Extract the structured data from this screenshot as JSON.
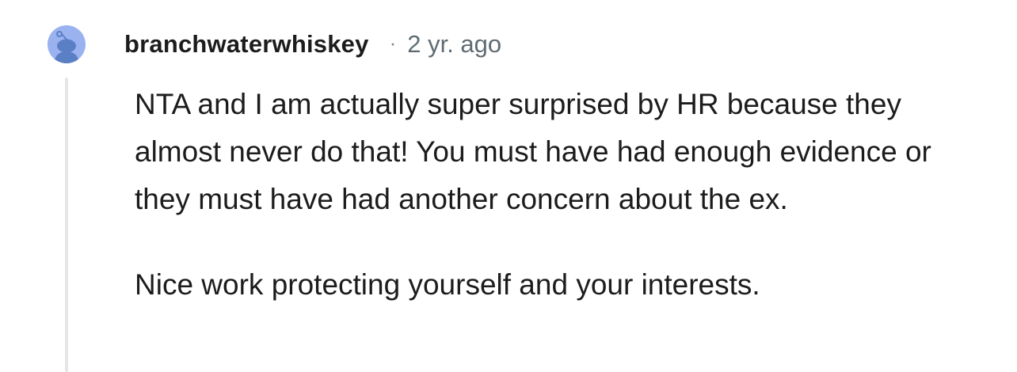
{
  "comment": {
    "author": "branchwaterwhiskey",
    "separator": "·",
    "timestamp": "2 yr. ago",
    "avatar_icon": "snoo-avatar-icon",
    "paragraphs": [
      "NTA and I am actually super surprised by HR because they almost never do that! You must have had enough evidence or they must have had another concern about the ex.",
      "Nice work protecting yourself and your interests."
    ]
  },
  "colors": {
    "avatar_bg": "#9ab3f0",
    "avatar_figure": "#5b7fc4",
    "thread_line": "#e6e6e6",
    "text": "#1c1c1c",
    "meta_text": "#5f6b73"
  }
}
